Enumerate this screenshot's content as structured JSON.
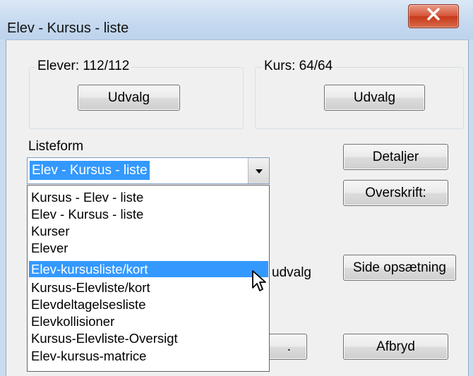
{
  "window": {
    "title": "Elev - Kursus - liste",
    "close_glyph": "X"
  },
  "students_group": {
    "label": "Elever: 112/112",
    "button_label": "Udvalg"
  },
  "courses_group": {
    "label": "Kurs: 64/64",
    "button_label": "Udvalg"
  },
  "listform": {
    "label": "Listeform",
    "selected_value": "Elev - Kursus - liste",
    "options": [
      "Kursus - Elev - liste",
      "Elev - Kursus - liste",
      "Kurser",
      "Elever",
      "Elev-kursusliste/kort",
      "Kursus-Elevliste/kort",
      "Elevdeltagelsesliste",
      "Elevkollisioner",
      "Kursus-Elevliste-Oversigt",
      "Elev-kursus-matrice"
    ],
    "highlighted_index": 4
  },
  "buttons": {
    "details": "Detaljer",
    "heading": "Overskrift:",
    "page_setup": "Side opsætning",
    "cancel": "Afbryd",
    "partial_left": "."
  },
  "partial_text": "udvalg",
  "icons": {
    "close": "close-icon",
    "dropdown": "chevron-down-icon",
    "cursor": "mouse-pointer-icon"
  },
  "colors": {
    "selection": "#3399ff",
    "close_button": "#c94a2b",
    "titlebar": "#c6daf0"
  }
}
